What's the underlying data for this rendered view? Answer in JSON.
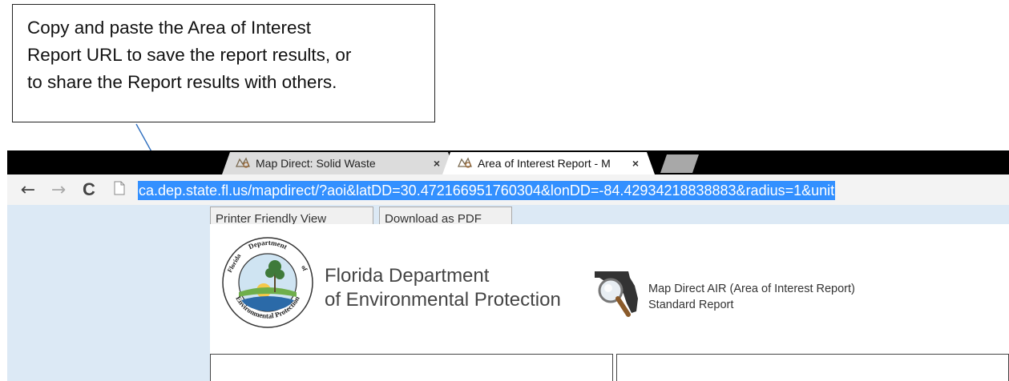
{
  "callout": {
    "lines": [
      "Copy and paste the Area of Interest",
      "Report URL to save the report results, or",
      "to share the Report results with others."
    ]
  },
  "browser": {
    "tabs": [
      {
        "title": "Map Direct: Solid Waste",
        "close": "×"
      },
      {
        "title": "Area of Interest Report - M",
        "close": "×"
      }
    ],
    "nav": {
      "back": "←",
      "forward": "→",
      "reload": "C"
    },
    "url": "ca.dep.state.fl.us/mapdirect/?aoi&latDD=30.472166951760304&lonDD=-84.42934218838883&radius=1&unit"
  },
  "page": {
    "buttons": {
      "printer": "Printer Friendly View",
      "pdf": "Download as PDF"
    },
    "dept_line1": "Florida Department",
    "dept_line2": "of Environmental Protection",
    "report_line1": "Map Direct AIR (Area of Interest Report)",
    "report_line2": "Standard Report",
    "seal_top": "Department",
    "seal_left": "Florida",
    "seal_right": "of",
    "seal_bottom": "Environmental Protection"
  },
  "colors": {
    "url_highlight": "#3390ff",
    "content_bg": "#dce9f5",
    "tabbar_bg": "#000000",
    "arrow": "#2f6fbf"
  }
}
